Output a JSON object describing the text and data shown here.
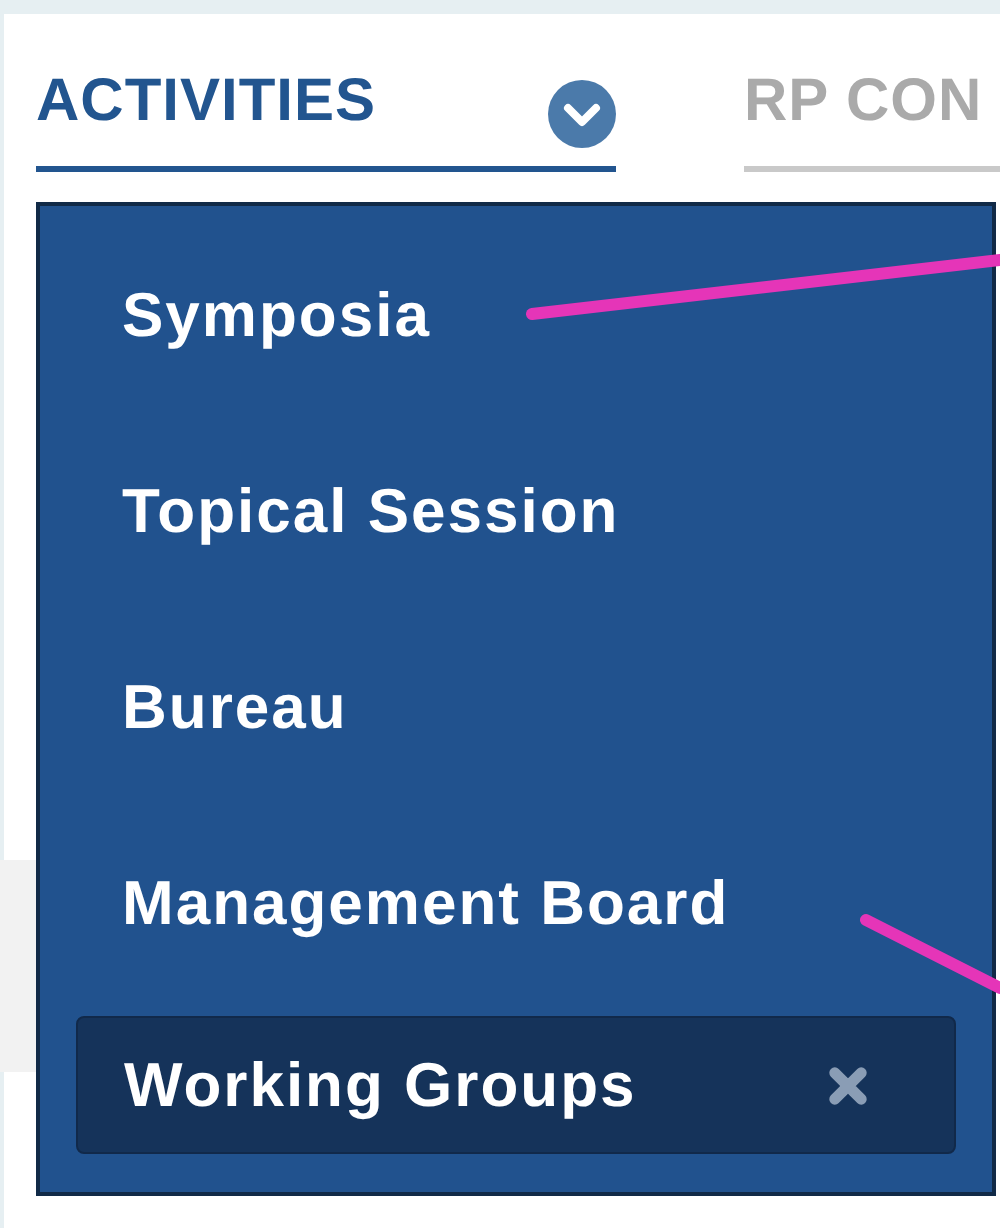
{
  "tabs": [
    {
      "label": "ACTIVITIES",
      "selected": true,
      "expanded": true
    },
    {
      "label": "RP CON",
      "selected": false
    }
  ],
  "menu": {
    "items": [
      {
        "label": "Symposia",
        "selected": false
      },
      {
        "label": "Topical Session",
        "selected": false
      },
      {
        "label": "Bureau",
        "selected": false
      },
      {
        "label": "Management Board",
        "selected": false
      },
      {
        "label": "Working Groups",
        "selected": true
      }
    ]
  }
}
